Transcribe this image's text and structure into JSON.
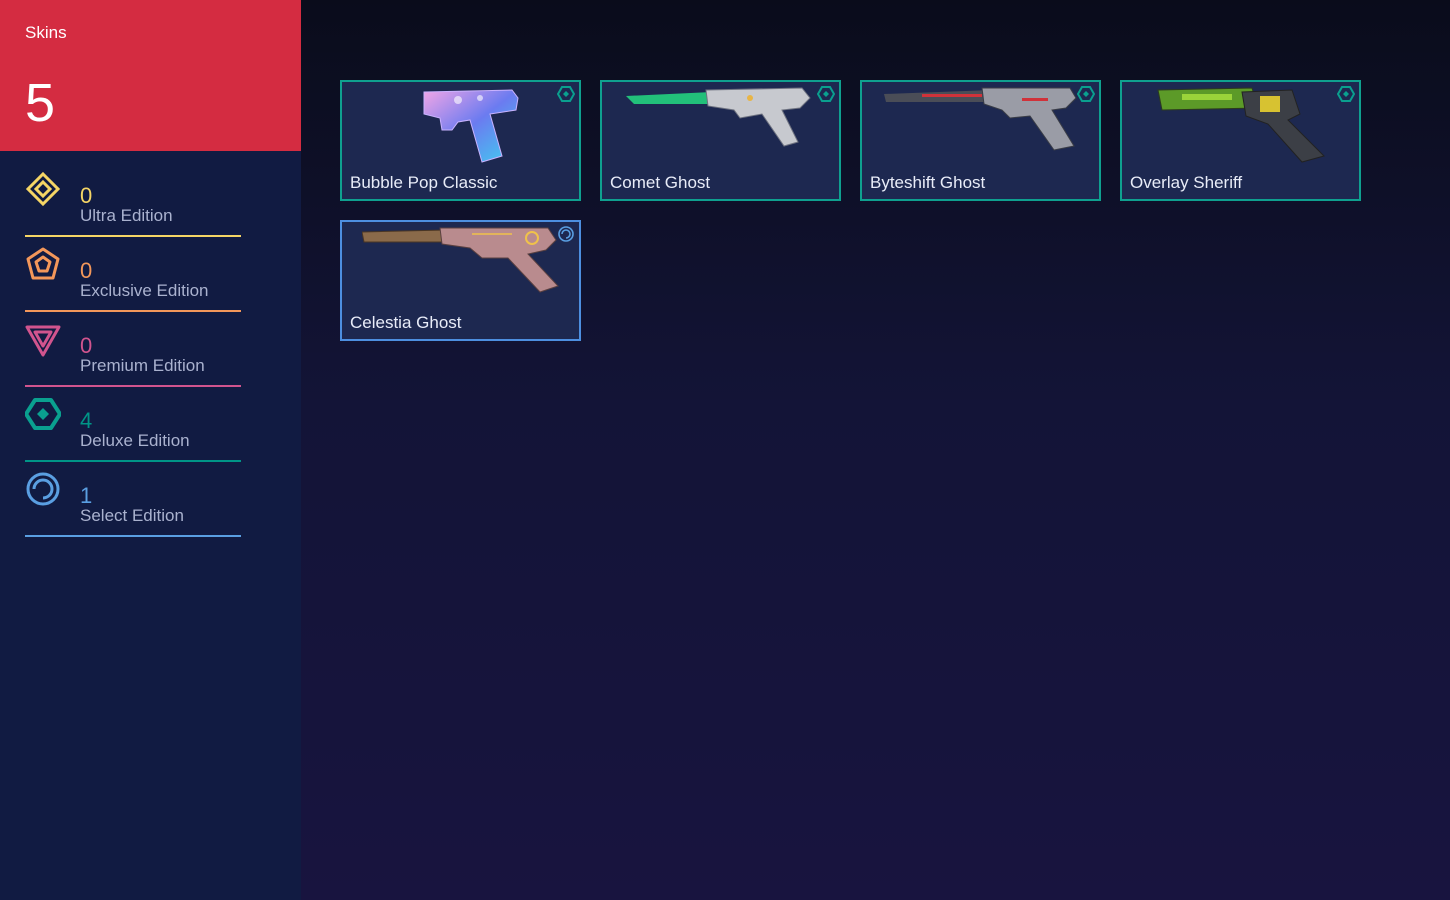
{
  "summary": {
    "label": "Skins",
    "count": "5"
  },
  "tiers": [
    {
      "name": "Ultra Edition",
      "count": "0",
      "color": "#f5d565",
      "icon": "ultra-diamond-icon"
    },
    {
      "name": "Exclusive Edition",
      "count": "0",
      "color": "#f3975a",
      "icon": "exclusive-pentagon-icon"
    },
    {
      "name": "Premium Edition",
      "count": "0",
      "color": "#d1548e",
      "icon": "premium-triangle-icon"
    },
    {
      "name": "Deluxe Edition",
      "count": "4",
      "color": "#009587",
      "icon": "deluxe-diamond-icon"
    },
    {
      "name": "Select Edition",
      "count": "1",
      "color": "#5a9fe2",
      "icon": "select-ring-icon"
    }
  ],
  "skins": [
    {
      "name": "Bubble Pop Classic",
      "tier": "Deluxe Edition",
      "border": "#0fa08f",
      "icon": "pistol-image"
    },
    {
      "name": "Comet Ghost",
      "tier": "Deluxe Edition",
      "border": "#0fa08f",
      "icon": "pistol-image"
    },
    {
      "name": "Byteshift Ghost",
      "tier": "Deluxe Edition",
      "border": "#0fa08f",
      "icon": "pistol-image"
    },
    {
      "name": "Overlay Sheriff",
      "tier": "Deluxe Edition",
      "border": "#0fa08f",
      "icon": "revolver-image"
    },
    {
      "name": "Celestia Ghost",
      "tier": "Select Edition",
      "border": "#4d8fe0",
      "icon": "pistol-image"
    }
  ]
}
